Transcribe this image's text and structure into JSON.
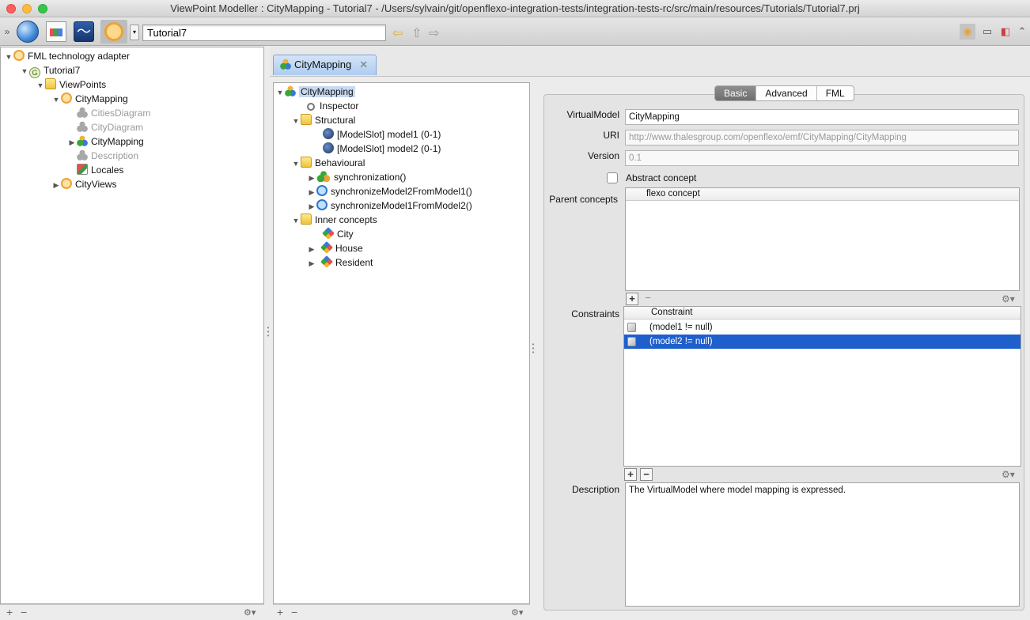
{
  "window": {
    "title": "ViewPoint Modeller : CityMapping - Tutorial7 - /Users/sylvain/git/openflexo-integration-tests/integration-tests-rc/src/main/resources/Tutorials/Tutorial7.prj"
  },
  "toolbar": {
    "project_field": "Tutorial7",
    "icons": [
      "chevron-double-icon",
      "globe-icon",
      "document-icon",
      "fish-icon",
      "fml-icon"
    ],
    "right_icons": [
      "fml-perspective-icon",
      "window-icon",
      "panel-icon",
      "collapse-icon"
    ]
  },
  "left_tree": {
    "root": "FML technology adapter",
    "tutorial": "Tutorial7",
    "viewpoints": "ViewPoints",
    "citymapping": "CityMapping",
    "cities_diagram": "CitiesDiagram",
    "city_diagram": "CityDiagram",
    "citymapping_vm": "CityMapping",
    "description": "Description",
    "locales": "Locales",
    "cityviews": "CityViews"
  },
  "editor": {
    "tab_label": "CityMapping",
    "tree": {
      "root": "CityMapping",
      "inspector": "Inspector",
      "structural": "Structural",
      "slot1": "[ModelSlot] model1 (0-1)",
      "slot2": "[ModelSlot] model2 (0-1)",
      "behavioural": "Behavioural",
      "sync": "synchronization()",
      "sync2": "synchronizeModel2FromModel1()",
      "sync1": "synchronizeModel1FromModel2()",
      "inner": "Inner concepts",
      "city": "City",
      "house": "House",
      "resident": "Resident"
    }
  },
  "inspector": {
    "tabs": [
      "Basic",
      "Advanced",
      "FML"
    ],
    "active_tab": "Basic",
    "virtual_model_label": "VirtualModel",
    "virtual_model_value": "CityMapping",
    "uri_label": "URI",
    "uri_value": "http://www.thalesgroup.com/openflexo/emf/CityMapping/CityMapping",
    "version_label": "Version",
    "version_value": "0.1",
    "abstract_label": "Abstract concept",
    "parent_concepts_label": "Parent concepts",
    "parent_concepts_header": "flexo concept",
    "constraints_label": "Constraints",
    "constraints_header": "Constraint",
    "constraints": [
      "(model1 != null)",
      "(model2 != null)"
    ],
    "description_label": "Description",
    "description_value": "The VirtualModel where model mapping is expressed."
  },
  "footer": {
    "add": "+",
    "remove": "−",
    "gear": "⚙▾"
  }
}
